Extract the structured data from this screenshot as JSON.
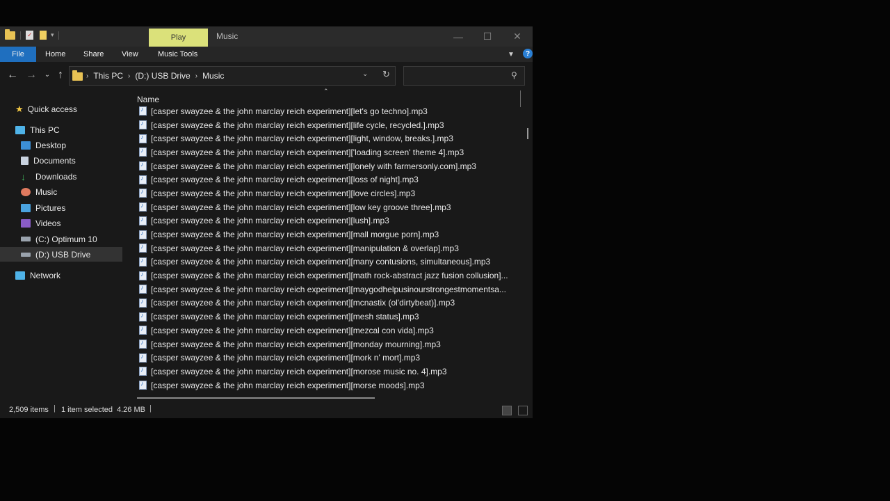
{
  "titlebar": {
    "context_tab": "Play",
    "title": "Music",
    "minimize_icon": "minimize-icon",
    "maximize_icon": "maximize-icon",
    "close_icon": "close-icon"
  },
  "ribbon": {
    "tabs": [
      "File",
      "Home",
      "Share",
      "View",
      "Music Tools"
    ],
    "help": "?"
  },
  "address": {
    "crumbs": [
      "This PC",
      "(D:) USB Drive",
      "Music"
    ],
    "search_placeholder": ""
  },
  "sidebar": {
    "items": [
      {
        "label": "Quick access",
        "icon": "star-icon"
      },
      {
        "label": "This PC",
        "icon": "computer-icon"
      },
      {
        "label": "Desktop",
        "icon": "desktop-icon"
      },
      {
        "label": "Documents",
        "icon": "documents-icon"
      },
      {
        "label": "Downloads",
        "icon": "downloads-icon"
      },
      {
        "label": "Music",
        "icon": "music-icon"
      },
      {
        "label": "Pictures",
        "icon": "pictures-icon"
      },
      {
        "label": "Videos",
        "icon": "videos-icon"
      },
      {
        "label": "(C:) Optimum 10",
        "icon": "drive-icon"
      },
      {
        "label": "(D:) USB Drive",
        "icon": "usb-drive-icon"
      },
      {
        "label": "Network",
        "icon": "network-icon"
      }
    ]
  },
  "filelist": {
    "column_header": "Name",
    "files": [
      "[casper swayzee & the john marclay reich experiment][let's go techno].mp3",
      "[casper swayzee & the john marclay reich experiment][life cycle, recycled.].mp3",
      "[casper swayzee & the john marclay reich experiment][light, window, breaks.].mp3",
      "[casper swayzee & the john marclay reich experiment]['loading screen' theme 4].mp3",
      "[casper swayzee & the john marclay reich experiment][lonely with farmersonly.com].mp3",
      "[casper swayzee & the john marclay reich experiment][loss of night].mp3",
      "[casper swayzee & the john marclay reich experiment][love circles].mp3",
      "[casper swayzee & the john marclay reich experiment][low key groove three].mp3",
      "[casper swayzee & the john marclay reich experiment][lush].mp3",
      "[casper swayzee & the john marclay reich experiment][mall morgue porn].mp3",
      "[casper swayzee & the john marclay reich experiment][manipulation & overlap].mp3",
      "[casper swayzee & the john marclay reich experiment][many contusions, simultaneous].mp3",
      "[casper swayzee & the john marclay reich experiment][math rock-abstract jazz fusion collusion]...",
      "[casper swayzee & the john marclay reich experiment][maygodhelpusinourstrongestmomentsa...",
      "[casper swayzee & the john marclay reich experiment][mcnastix (ol'dirtybeat)].mp3",
      "[casper swayzee & the john marclay reich experiment][mesh status].mp3",
      "[casper swayzee & the john marclay reich experiment][mezcal con vida].mp3",
      "[casper swayzee & the john marclay reich experiment][monday mourning].mp3",
      "[casper swayzee & the john marclay reich experiment][mork n' mort].mp3",
      "[casper swayzee & the john marclay reich experiment][morose music no. 4].mp3",
      "[casper swayzee & the john marclay reich experiment][morse moods].mp3"
    ]
  },
  "status": {
    "items": "2,509 items",
    "selected": "1 item selected",
    "size": "4.26 MB"
  }
}
